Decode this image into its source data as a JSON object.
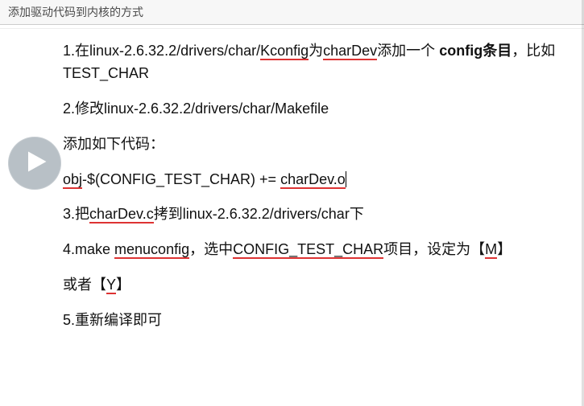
{
  "title": "添加驱动代码到内核的方式",
  "paragraphs": {
    "p1a": "1.在linux-2.6.32.2/drivers/char/",
    "p1b": "Kconfig",
    "p1c": "为",
    "p1d": "charDev",
    "p1e": "添加一个",
    "p1f": "config条目",
    "p1g": "，比如TEST_CHAR",
    "p2": "2.修改linux-2.6.32.2/drivers/char/Makefile",
    "p3": "添加如下代码：",
    "p4a": "obj",
    "p4b": "-$(CONFIG_TEST_CHAR) += ",
    "p4c": "charDev.o",
    "p5a": "3.把",
    "p5b": "charDev.c",
    "p5c": "拷到linux-2.6.32.2/drivers/char下",
    "p6a": "4.make ",
    "p6b": "menuconfig",
    "p6c": "，选中",
    "p6d": "CONFIG_TEST_CHAR",
    "p6e": "项目，设定为【",
    "p6f": "M",
    "p6g": "】",
    "p7a": "或者【",
    "p7b": "Y",
    "p7c": "】",
    "p8": "5.重新编译即可"
  }
}
